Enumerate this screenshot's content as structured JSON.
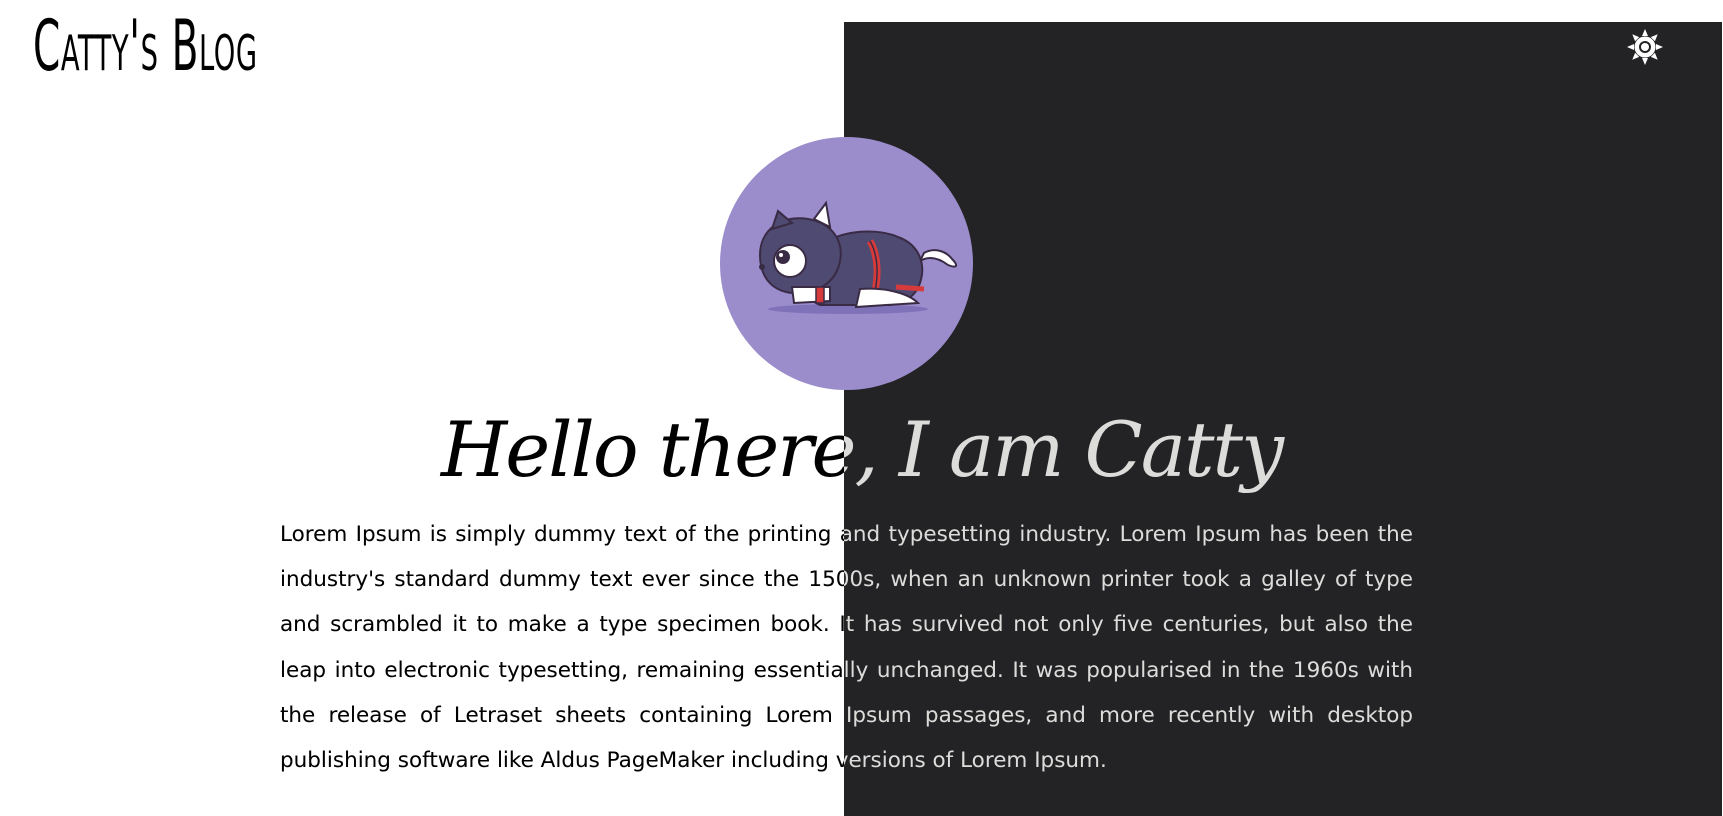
{
  "header": {
    "site_title": "Catty's Blog",
    "theme_toggle_icon": "sun-icon"
  },
  "hero": {
    "avatar_icon": "cat-icon",
    "avatar_bg": "#9b8dcc",
    "heading": "Hello there, I am Catty",
    "intro": "Lorem Ipsum is simply dummy text of the printing and typesetting industry. Lorem Ipsum has been the industry's standard dummy text ever since the 1500s, when an unknown printer took a galley of type and scrambled it to make a type specimen book. It has survived not only five centuries, but also the leap into electronic typesetting, remaining essentially unchanged. It was popularised in the 1960s with the release of Letraset sheets containing Lorem Ipsum passages, and more recently with desktop publishing software like Aldus PageMaker including versions of Lorem Ipsum."
  },
  "colors": {
    "light_bg": "#ffffff",
    "dark_bg": "#232325",
    "text": "#000000"
  }
}
